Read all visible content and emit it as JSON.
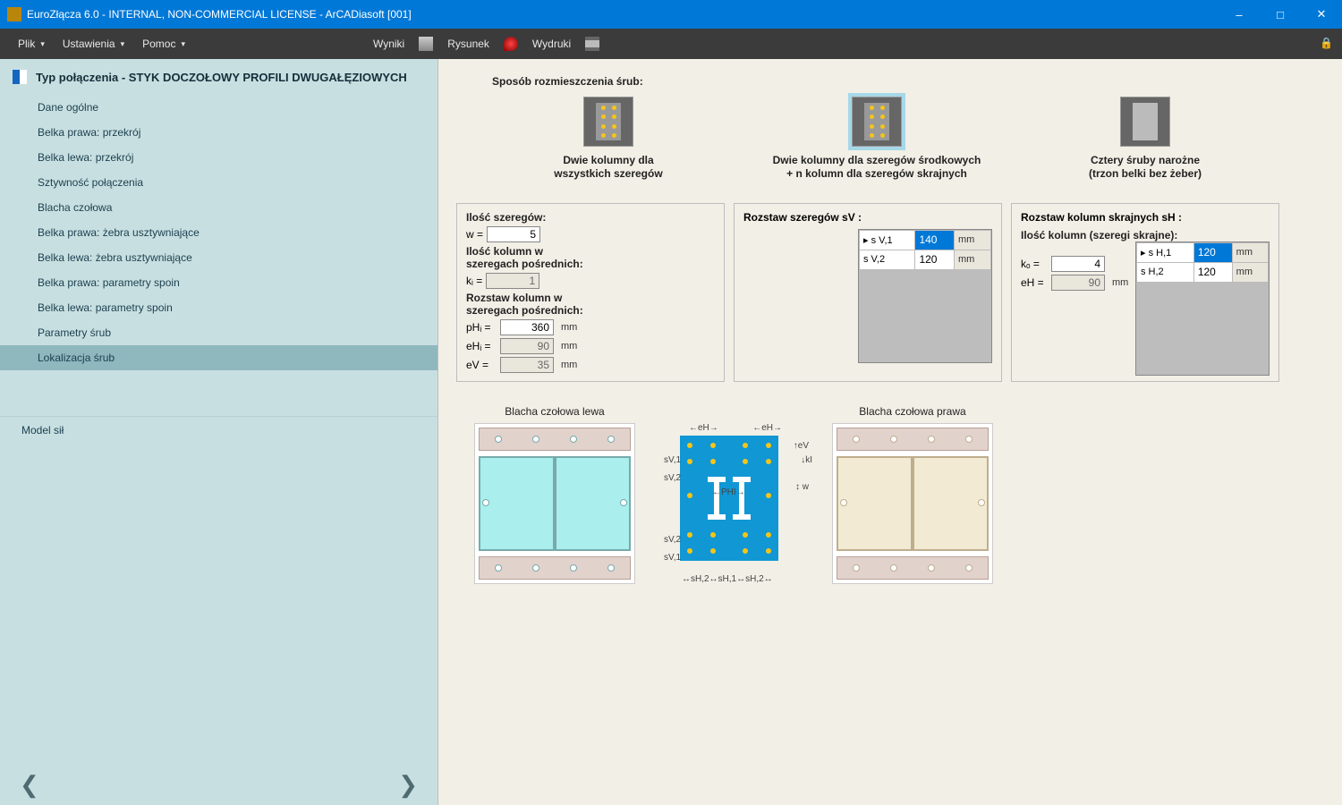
{
  "title": "EuroZłącza 6.0 - INTERNAL, NON-COMMERCIAL LICENSE - ArCADiasoft [001]",
  "menu": {
    "plik": "Plik",
    "ustawienia": "Ustawienia",
    "pomoc": "Pomoc",
    "wyniki": "Wyniki",
    "rysunek": "Rysunek",
    "wydruki": "Wydruki"
  },
  "sidebar": {
    "header": "Typ połączenia - STYK DOCZOŁOWY PROFILI DWUGAŁĘZIOWYCH",
    "items": [
      "Dane ogólne",
      "Belka prawa: przekrój",
      "Belka lewa: przekrój",
      "Sztywność połączenia",
      "Blacha czołowa",
      "Belka prawa: żebra usztywniające",
      "Belka lewa: żebra usztywniające",
      "Belka prawa: parametry spoin",
      "Belka lewa: parametry spoin",
      "Parametry śrub",
      "Lokalizacja śrub"
    ],
    "model": "Model sił"
  },
  "options": {
    "heading": "Sposób rozmieszczenia śrub:",
    "a": {
      "l1": "Dwie kolumny dla",
      "l2": "wszystkich szeregów"
    },
    "b": {
      "l1": "Dwie kolumny dla szeregów środkowych",
      "l2": "+ n kolumn dla szeregów skrajnych"
    },
    "c": {
      "l1": "Cztery śruby narożne",
      "l2": "(trzon belki bez żeber)"
    }
  },
  "p1": {
    "t_rows": "Ilość szeregów:",
    "w_lab": "w  =",
    "w": "5",
    "t_cols": "Ilość kolumn w\nszeregach pośrednich:",
    "ki_lab": "kᵢ =",
    "ki": "1",
    "t_spc": "Rozstaw kolumn w\nszeregach pośrednich:",
    "pHi_lab": "pHᵢ =",
    "pHi": "360",
    "eHi_lab": "eHᵢ =",
    "eHi": "90",
    "eV_lab": "eV  =",
    "eV": "35",
    "mm": "mm"
  },
  "p2": {
    "title": "Rozstaw szeregów  sV :",
    "rows": [
      {
        "lab": "▸ s V,1",
        "val": "140",
        "u": "mm",
        "hl": true
      },
      {
        "lab": "  s V,2",
        "val": "120",
        "u": "mm",
        "hl": false
      }
    ]
  },
  "p3": {
    "title": "Rozstaw kolumn skrajnych  sH :",
    "sub": "Ilość kolumn (szeregi skrajne):",
    "ko_lab": "kₒ =",
    "ko": "4",
    "eH_lab": "eH =",
    "eH": "90",
    "mm": "mm",
    "rows": [
      {
        "lab": "▸ s H,1",
        "val": "120",
        "u": "mm",
        "hl": true
      },
      {
        "lab": "  s H,2",
        "val": "120",
        "u": "mm",
        "hl": false
      }
    ]
  },
  "plates": {
    "left": "Blacha czołowa lewa",
    "right": "Blacha czołowa prawa"
  }
}
